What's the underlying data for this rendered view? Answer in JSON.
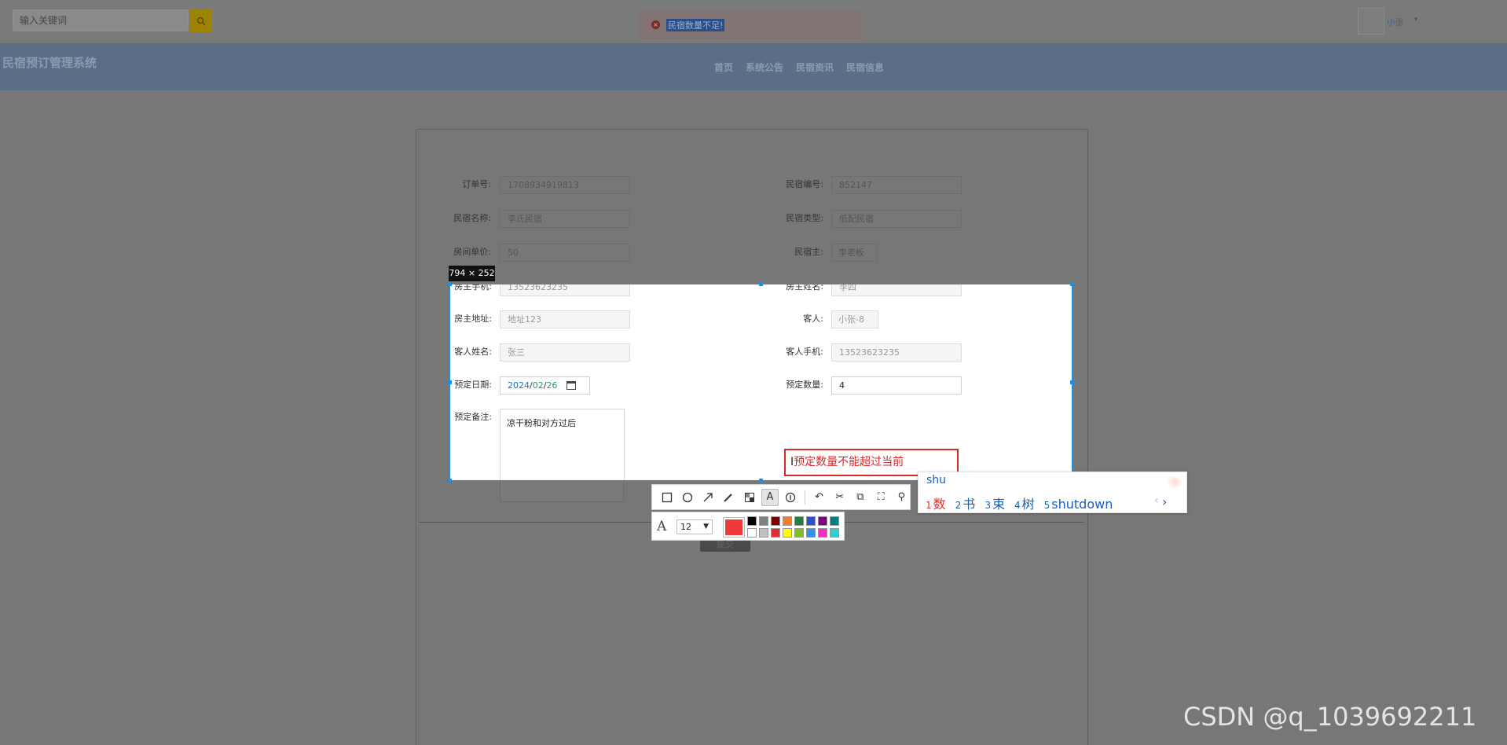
{
  "header": {
    "search_placeholder": "输入关键词",
    "toast_message": "民宿数量不足!",
    "user_name": "小张",
    "user_caret": "▾"
  },
  "nav": {
    "site_title": "民宿预订管理系统",
    "links": [
      "首页",
      "系统公告",
      "民宿资讯",
      "民宿信息"
    ]
  },
  "form": {
    "order_no_label": "订单号:",
    "order_no": "1708934919813",
    "house_no_label": "民宿编号:",
    "house_no": "852147",
    "house_name_label": "民宿名称:",
    "house_name": "李氏民宿",
    "house_type_label": "民宿类型:",
    "house_type": "低配民宿",
    "room_price_label": "房间单价:",
    "room_price": "50",
    "owner_label": "民宿主:",
    "owner": "李老板",
    "owner_phone_label": "房主手机:",
    "owner_phone": "13523623235",
    "owner_name_label": "房主姓名:",
    "owner_name": "李四",
    "owner_address_label": "房主地址:",
    "owner_address": "地址123",
    "guest_label": "客人:",
    "guest": "小张-8",
    "guest_name_label": "客人姓名:",
    "guest_name": "张三",
    "guest_phone_label": "客人手机:",
    "guest_phone": "13523623235",
    "date_label": "预定日期:",
    "date_year": "2024",
    "date_month": "02",
    "date_day": "26",
    "quantity_label": "预定数量:",
    "quantity": "4",
    "remark_label": "预定备注:",
    "remark": "凉干粉和对方过后",
    "submit_label": "提交"
  },
  "capture": {
    "size_tag": "794 × 252",
    "annotation_text": "预定数量不能超过当前",
    "font_size": "12",
    "current_color": "#f03a3a",
    "palette": [
      "#000000",
      "#808080",
      "#800000",
      "#f08030",
      "#208040",
      "#3050d0",
      "#800080",
      "#008080",
      "#ffffff",
      "#c0c0c0",
      "#e03030",
      "#ffff00",
      "#80c020",
      "#3090f0",
      "#f030c0",
      "#30d0d0"
    ],
    "tools": [
      "rectangle-icon",
      "ellipse-icon",
      "arrow-icon",
      "pen-icon",
      "mosaic-icon",
      "text-icon",
      "number-icon",
      "undo-icon",
      "delete-icon",
      "copy-icon",
      "fullscreen-icon",
      "pin-icon"
    ]
  },
  "ime": {
    "input": "shu",
    "candidates": [
      {
        "num": "1",
        "text": "数"
      },
      {
        "num": "2",
        "text": "书"
      },
      {
        "num": "3",
        "text": "束"
      },
      {
        "num": "4",
        "text": "树"
      },
      {
        "num": "5",
        "text": "shutdown"
      }
    ],
    "prev": "‹",
    "next": "›"
  },
  "watermark": "CSDN @q_1039692211"
}
